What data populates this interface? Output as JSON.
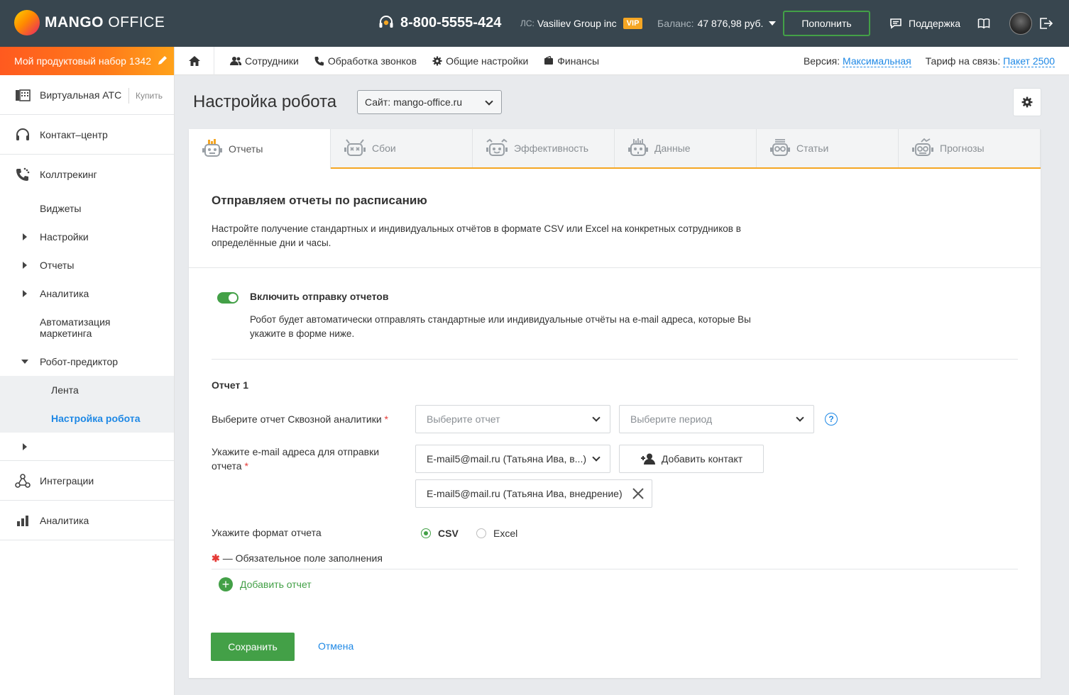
{
  "header": {
    "logo_bold": "MANGO",
    "logo_light": " OFFICE",
    "phone": "8-800-5555-424",
    "account_label": "ЛС:",
    "account_name": "Vasiliev Group inc",
    "vip": "VIP",
    "balance_label": "Баланс:",
    "balance_value": "47 876,98 руб.",
    "topup": "Пополнить",
    "support": "Поддержка"
  },
  "sidebar": {
    "kit": "Мой продуктовый набор 1342",
    "pbx": "Виртуальная АТС",
    "buy": "Купить",
    "contact_center": "Контакт–центр",
    "calltracking": "Коллтрекинг",
    "widgets": "Виджеты",
    "settings": "Настройки",
    "reports": "Отчеты",
    "analytics_sub": "Аналитика",
    "automation": "Автоматизация маркетинга",
    "robot": "Робот-предиктор",
    "feed": "Лента",
    "robot_settings": "Настройка робота",
    "integrations": "Интеграции",
    "analytics": "Аналитика"
  },
  "subnav": {
    "employees": "Сотрудники",
    "calls": "Обработка звонков",
    "general": "Общие настройки",
    "finance": "Финансы",
    "version_label": "Версия: ",
    "version_value": "Максимальная",
    "tariff_label": "Тариф на связь: ",
    "tariff_value": "Пакет 2500"
  },
  "page": {
    "title": "Настройка робота",
    "site_select": "Сайт: mango-office.ru"
  },
  "tabs": [
    "Отчеты",
    "Сбои",
    "Эффективность",
    "Данные",
    "Статьи",
    "Прогнозы"
  ],
  "intro": {
    "heading": "Отправляем отчеты по расписанию",
    "text": "Настройте получение стандартных и индивидуальных отчётов в формате CSV или Excel на конкретных сотрудников в определённые дни и часы."
  },
  "toggle": {
    "label": "Включить отправку отчетов",
    "enabled": true,
    "desc": "Робот будет автоматически отправлять стандартные или индивидуальные отчёты на e-mail адреса, которые Вы укажите в форме ниже."
  },
  "form": {
    "report_title": "Отчет 1",
    "report_label": "Выберите отчет Сквозной аналитики",
    "report_placeholder": "Выберите отчет",
    "period_placeholder": "Выберите период",
    "help": "?",
    "email_label": "Укажите e-mail адреса для отправки отчета",
    "email_value": "E-mail5@mail.ru (Татьяна Ива, в...)",
    "add_contact": "Добавить контакт",
    "chip": "E-mail5@mail.ru (Татьяна Ива, внедрение)",
    "format_label": "Укажите формат отчета",
    "format_csv": "CSV",
    "format_excel": "Excel",
    "selected_format": "CSV",
    "required_note": "— Обязательное поле заполнения",
    "required_star": "*",
    "add_report": "Добавить отчет",
    "save": "Сохранить",
    "cancel": "Отмена"
  },
  "colors": {
    "topbar": "#38464f",
    "accent_green": "#43a047",
    "link_blue": "#1e88e5",
    "tab_underline": "#f5a623",
    "kit_orange": "#ff7a1a"
  }
}
